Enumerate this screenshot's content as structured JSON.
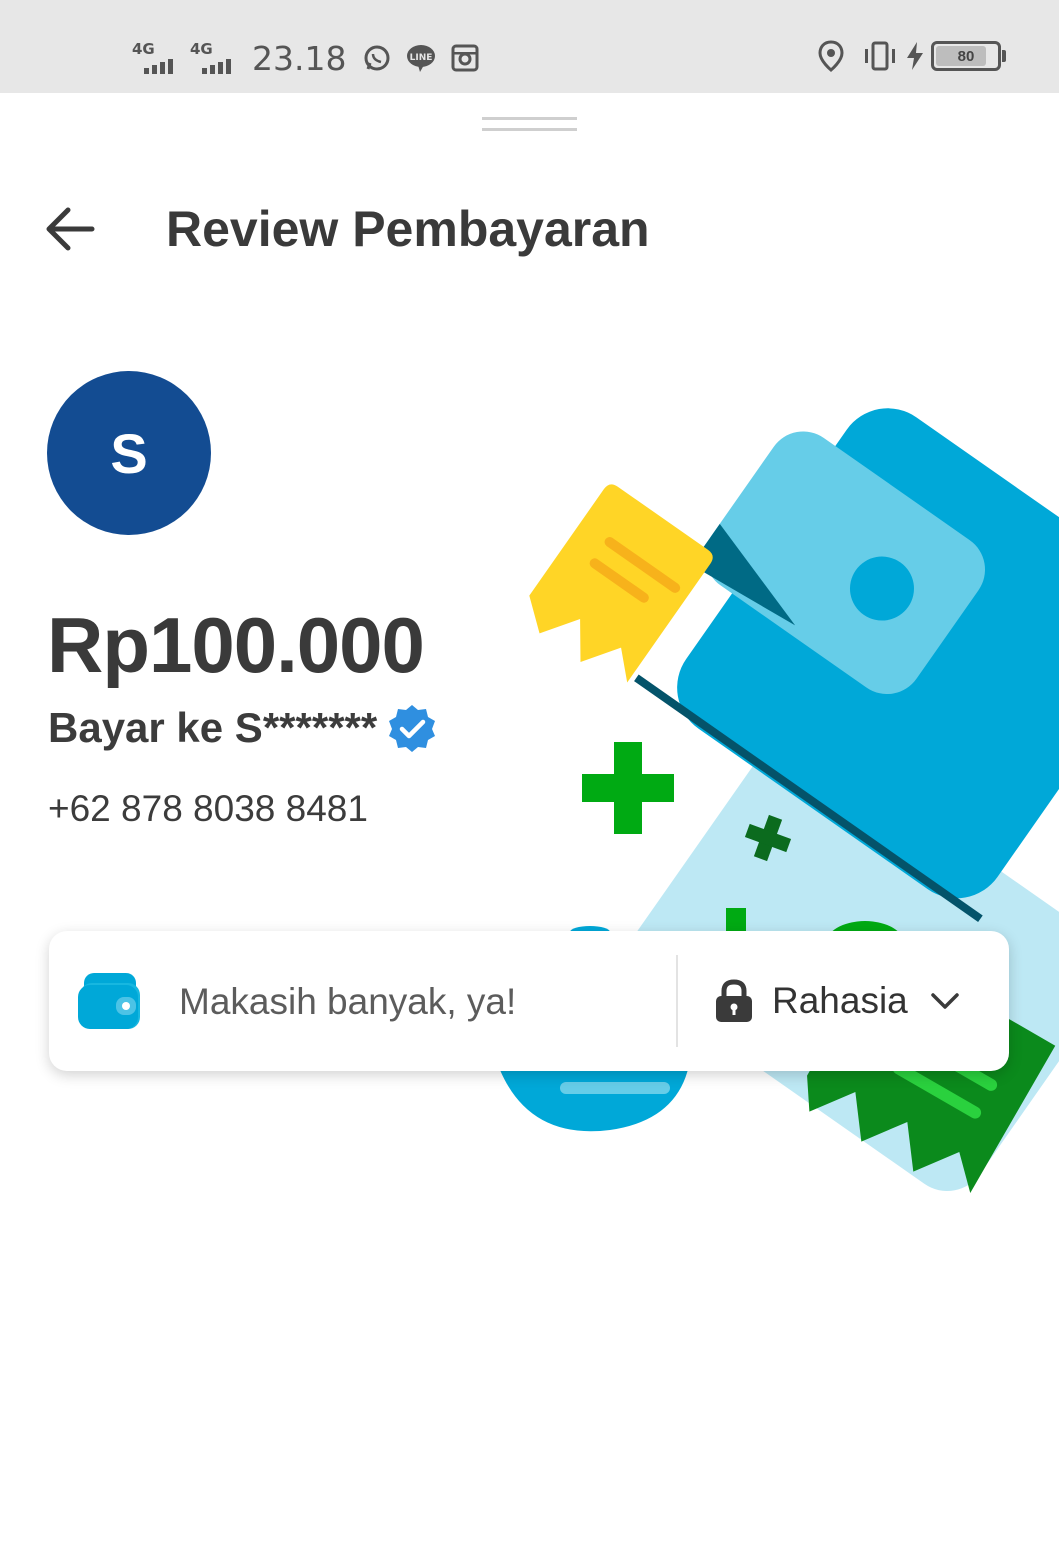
{
  "status_bar": {
    "signal_1_label": "4G",
    "signal_2_label": "4G",
    "time": "23.18",
    "notification_icons": [
      "whatsapp-icon",
      "line-icon",
      "instagram-icon"
    ],
    "right_icons": [
      "location-icon",
      "vibrate-icon",
      "charging-icon"
    ],
    "battery_level": "80"
  },
  "header": {
    "title": "Review Pembayaran",
    "back_icon": "arrow-left-icon"
  },
  "recipient": {
    "avatar_initial": "S",
    "amount": "Rp100.000",
    "pay_to": "Bayar ke S*******",
    "verified_icon": "verified-badge-icon",
    "phone": "+62 878 8038 8481"
  },
  "message_card": {
    "icon": "wallet-icon",
    "message": "Makasih banyak, ya!",
    "privacy_label": "Rahasia",
    "privacy_icon": "lock-icon",
    "dropdown_icon": "chevron-down-icon"
  },
  "colors": {
    "avatar_bg": "#134c92",
    "wallet_blue": "#00a8d8",
    "accent_green": "#00aa13",
    "verified_blue": "#2f8fe0",
    "receipt_yellow": "#ffd526"
  }
}
